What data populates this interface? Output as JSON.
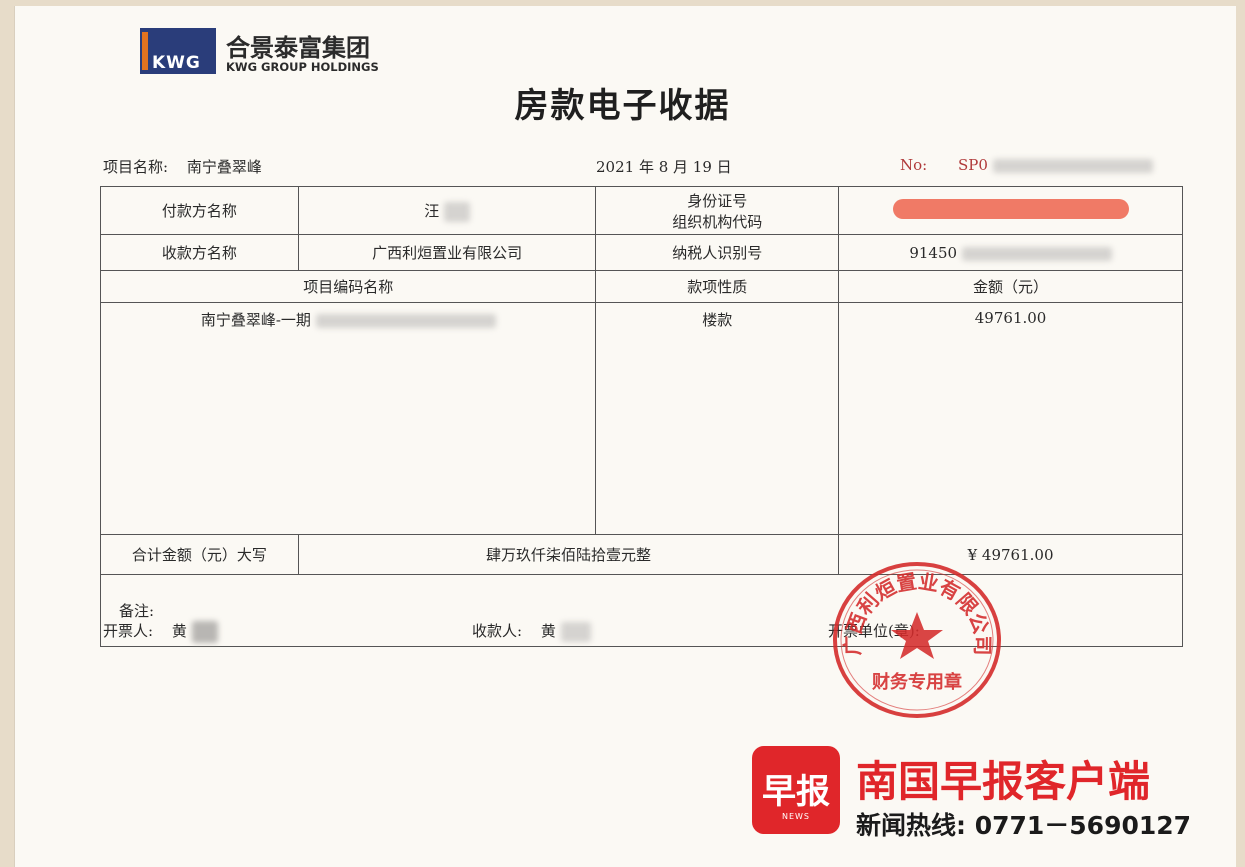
{
  "logo": {
    "cn_name": "合景泰富集团",
    "en_name": "KWG GROUP HOLDINGS",
    "mark_text": "KWG"
  },
  "title": "房款电子收据",
  "meta": {
    "project_label": "项目名称:",
    "project_name": "南宁叠翠峰",
    "date": "2021 年 8 月 19 日",
    "no_label": "No:",
    "no_value": "SP0"
  },
  "table": {
    "payer_label": "付款方名称",
    "payer_name": "汪",
    "id_label_line1": "身份证号",
    "id_label_line2": "组织机构代码",
    "payee_label": "收款方名称",
    "payee_name": "广西利烜置业有限公司",
    "tax_id_label": "纳税人识别号",
    "tax_id_value": "91450",
    "col_item": "项目编码名称",
    "col_nature": "款项性质",
    "col_amount": "金额（元）",
    "item_name": "南宁叠翠峰-一期",
    "item_nature": "楼款",
    "item_amount": "49761.00",
    "total_label": "合计金额（元）大写",
    "total_words": "肆万玖仟柒佰陆拾壹元整",
    "total_amount": "¥ 49761.00",
    "remarks_label": "备注:"
  },
  "signatures": {
    "issuer_label": "开票人:",
    "issuer_name": "黄",
    "payee_label": "收款人:",
    "payee_name": "黄",
    "unit_label": "开票单位(章):"
  },
  "seal": {
    "company_arc": "广西利烜置业有限公司",
    "purpose": "财务专用章",
    "color": "#d42b2b"
  },
  "news": {
    "badge_text": "早报",
    "badge_sub": "NEWS",
    "name": "南国早报客户端",
    "hotline": "新闻热线: 0771－5690127",
    "brand_color": "#e0262a"
  },
  "colors": {
    "redaction_bar": "#f07a66"
  }
}
